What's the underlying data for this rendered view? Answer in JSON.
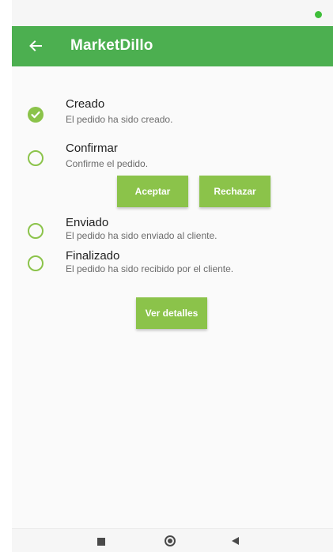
{
  "app": {
    "title": "MarketDillo",
    "accent_color": "#4caf50",
    "step_color": "#8bc34a"
  },
  "icons": {
    "back": "arrow-left-icon",
    "done": "check-circle-icon",
    "pending": "circle-outline-icon"
  },
  "steps": [
    {
      "title": "Creado",
      "subtitle": "El pedido ha sido creado.",
      "status": "done"
    },
    {
      "title": "Confirmar",
      "subtitle": "Confirme el pedido.",
      "status": "pending"
    },
    {
      "title": "Enviado",
      "subtitle": "El pedido ha sido enviado al cliente.",
      "status": "pending"
    },
    {
      "title": "Finalizado",
      "subtitle": "El pedido ha sido recibido por el cliente.",
      "status": "pending"
    }
  ],
  "actions": {
    "accept_label": "Aceptar",
    "reject_label": "Rechazar",
    "details_label": "Ver detalles"
  }
}
